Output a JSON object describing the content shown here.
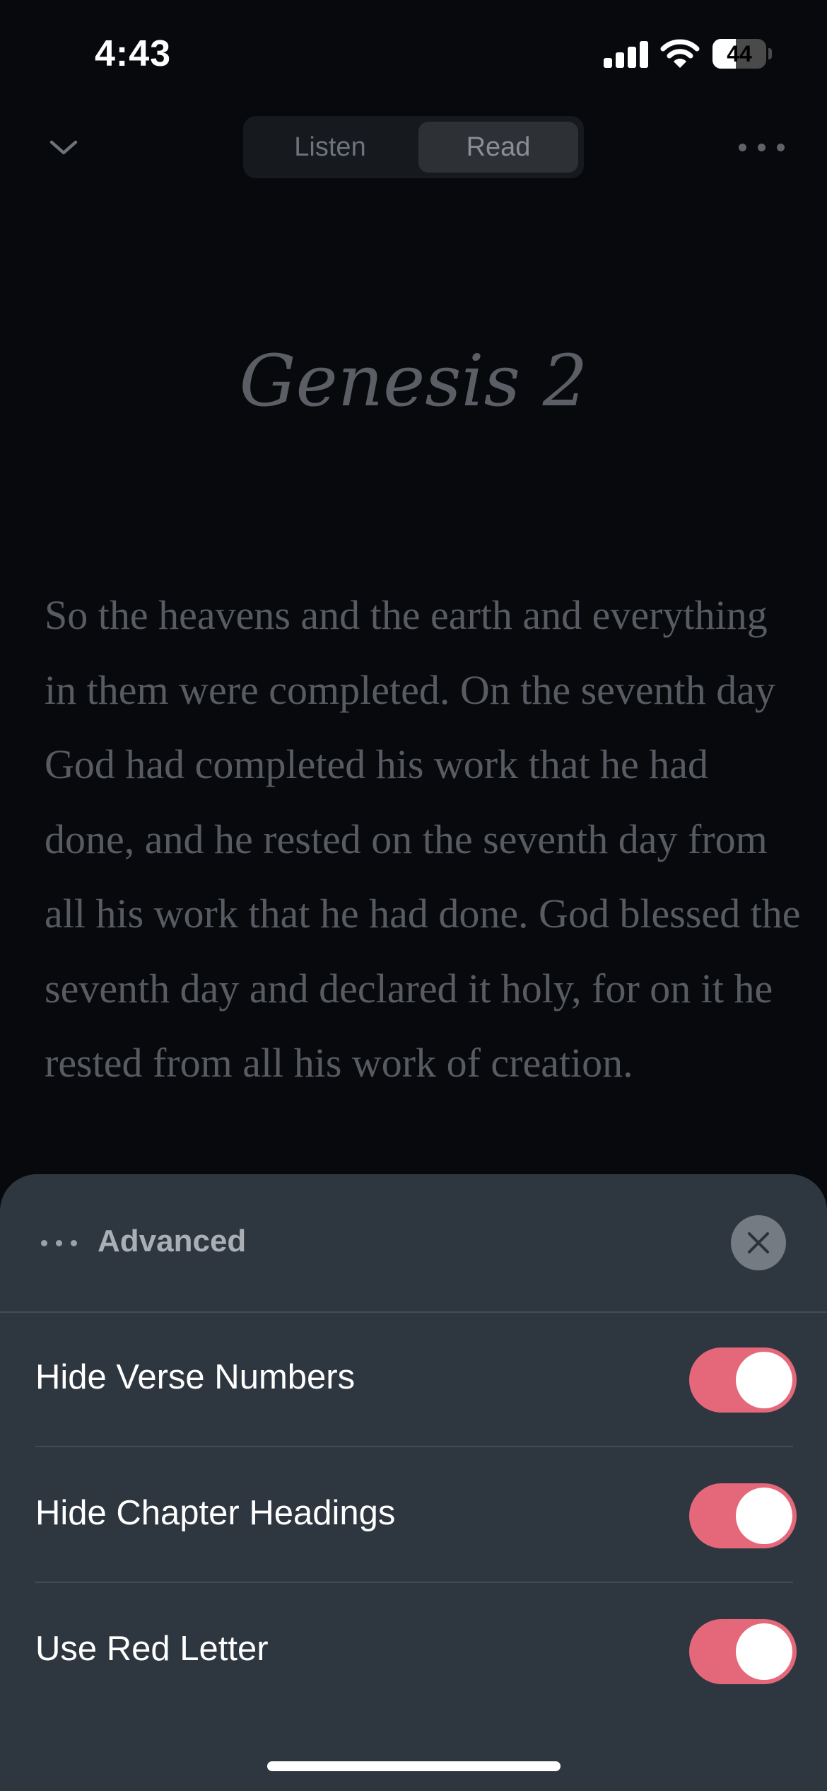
{
  "status_bar": {
    "time": "4:43",
    "battery": "44",
    "battery_level": 0.44
  },
  "header": {
    "tabs": [
      {
        "label": "Listen",
        "selected": false
      },
      {
        "label": "Read",
        "selected": true
      }
    ],
    "collapse_icon": "chevron-down-icon",
    "more_icon": "more-horizontal-icon"
  },
  "reader": {
    "chapter_title": "Genesis 2",
    "paragraph": "So the heavens and the earth and everything in them were completed. On the seventh day God had completed his work that he had done, and he rested on the seventh day from all his work that he had done. God blessed the seventh day and declared it holy, for on it he rested from all his work of creation."
  },
  "settings_sheet": {
    "title": "Advanced",
    "title_icon": "more-horizontal-icon",
    "close_icon": "close-icon",
    "options": [
      {
        "label": "Hide Verse Numbers",
        "on": true
      },
      {
        "label": "Hide Chapter Headings",
        "on": true
      },
      {
        "label": "Use Red Letter",
        "on": true
      }
    ]
  },
  "colors": {
    "toggle_on": "#e5677a",
    "sheet_bg": "#2e3740",
    "page_bg": "#07090d"
  }
}
